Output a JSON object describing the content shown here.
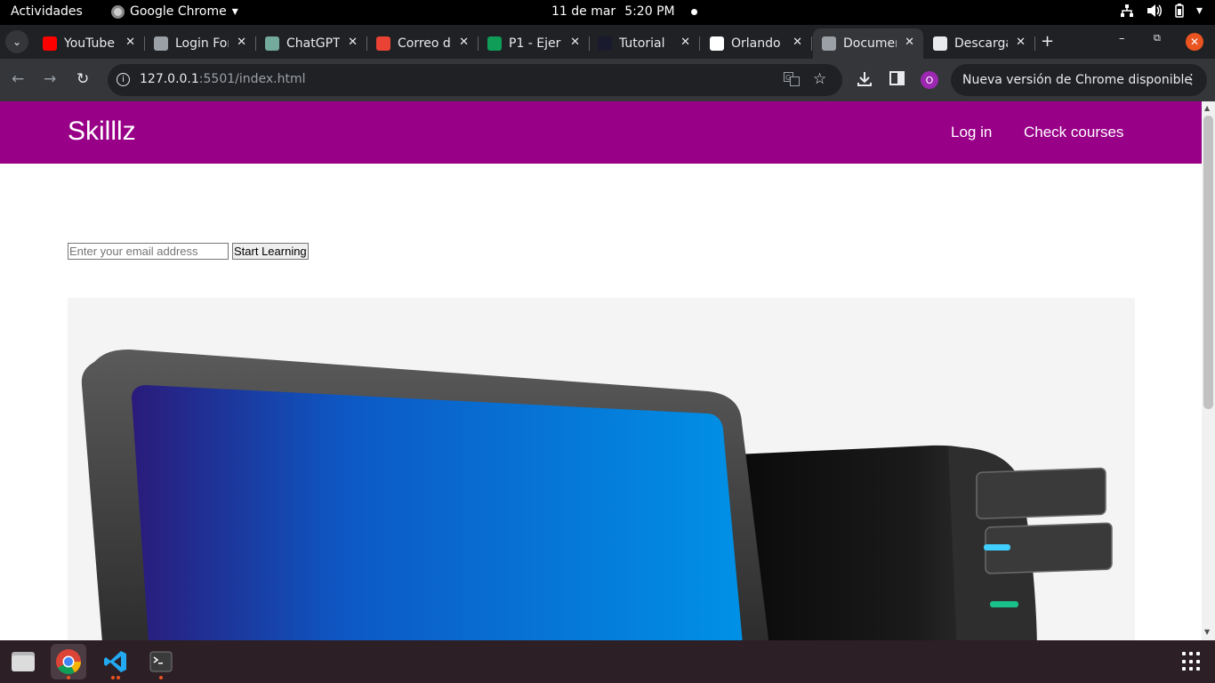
{
  "system": {
    "activities": "Actividades",
    "app_name": "Google Chrome",
    "date": "11 de mar",
    "time": "5:20 PM"
  },
  "tabs": [
    {
      "title": "YouTube",
      "icon": "youtube-icon",
      "color": "#ff0000"
    },
    {
      "title": "Login Form",
      "icon": "globe-icon",
      "color": "#9aa0a6"
    },
    {
      "title": "ChatGPT",
      "icon": "chatgpt-icon",
      "color": "#74aa9c"
    },
    {
      "title": "Correo de",
      "icon": "gmail-icon",
      "color": "#ea4335"
    },
    {
      "title": "P1 - Ejer",
      "icon": "classroom-icon",
      "color": "#0f9d58"
    },
    {
      "title": "Tutorial",
      "icon": "angular-icon",
      "color": "#1a1a2e"
    },
    {
      "title": "Orlando",
      "icon": "github-icon",
      "color": "#ffffff"
    },
    {
      "title": "Document",
      "icon": "globe-icon",
      "color": "#9aa0a6",
      "active": true
    },
    {
      "title": "Descargas",
      "icon": "download-icon",
      "color": "#e8eaed"
    }
  ],
  "toolbar": {
    "url_host": "127.0.0.1",
    "url_rest": ":5501/index.html",
    "profile_initial": "O",
    "update_label": "Nueva versión de Chrome disponible"
  },
  "page": {
    "brand": "Skilllz",
    "nav": {
      "login": "Log in",
      "courses": "Check courses"
    },
    "signup": {
      "email_placeholder": "Enter your email address",
      "button": "Start Learning"
    }
  },
  "colors": {
    "header_bg": "#990088",
    "chrome_dark": "#202124",
    "chrome_toolbar": "#35363a",
    "dock_bg": "#2c1f25",
    "accent": "#e95420"
  }
}
